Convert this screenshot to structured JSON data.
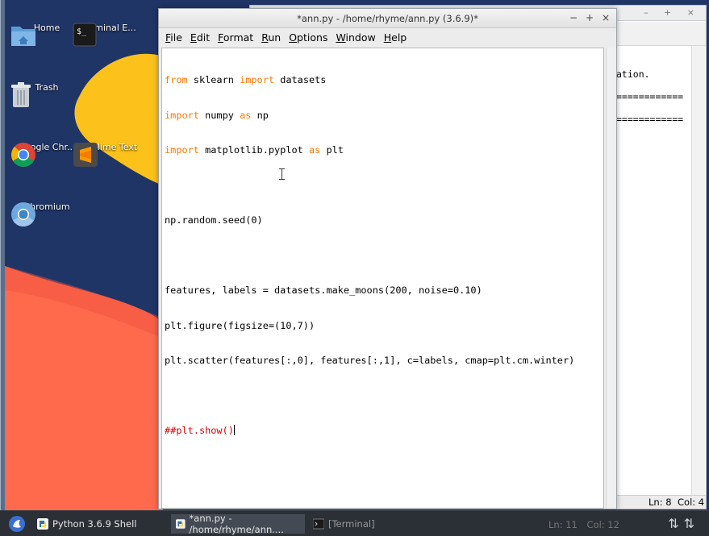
{
  "colors": {
    "desktop_bg": "#1f3566",
    "wave_orange": "#ff6a4d",
    "wave_yellow": "#fcc21b",
    "keyword": "#ff7700",
    "comment": "#dd0000",
    "taskbar_bg": "#2b2f36"
  },
  "desktop": {
    "icons": [
      {
        "label": "Home",
        "icon": "home-folder-icon"
      },
      {
        "label": "Terminal E...",
        "icon": "terminal-icon"
      },
      {
        "label": "Trash",
        "icon": "trash-icon"
      },
      {
        "label": "Google Chr...",
        "icon": "chrome-icon"
      },
      {
        "label": "Sublime Text",
        "icon": "sublime-icon"
      },
      {
        "label": "Chromium",
        "icon": "chromium-icon"
      }
    ]
  },
  "shell": {
    "text_lines": [
      "ation.",
      "",
      "============",
      "",
      "============"
    ],
    "status_ln": "Ln: 8",
    "status_col": "Col: 4"
  },
  "editor": {
    "title": "*ann.py - /home/rhyme/ann.py (3.6.9)*",
    "controls": {
      "minimize": "−",
      "maximize": "+",
      "close": "×"
    },
    "menu": [
      {
        "accel": "F",
        "rest": "ile"
      },
      {
        "accel": "E",
        "rest": "dit"
      },
      {
        "accel": "F",
        "rest": "ormat",
        "pre": ""
      },
      {
        "accel": "R",
        "rest": "un"
      },
      {
        "accel": "O",
        "rest": "ptions"
      },
      {
        "accel": "W",
        "rest": "indow"
      },
      {
        "accel": "H",
        "rest": "elp"
      }
    ],
    "code": {
      "line1": {
        "k1": "from",
        "t1": " sklearn ",
        "k2": "import",
        "t2": " datasets"
      },
      "line2": {
        "k1": "import",
        "t1": " numpy ",
        "k2": "as",
        "t2": " np"
      },
      "line3": {
        "k1": "import",
        "t1": " matplotlib.pyplot ",
        "k2": "as",
        "t2": " plt"
      },
      "line5": "np.random.seed(0)",
      "line7": "features, labels = datasets.make_moons(200, noise=0.10)",
      "line8": "plt.figure(figsize=(10,7))",
      "line9": "plt.scatter(features[:,0], features[:,1], c=labels, cmap=plt.cm.winter)",
      "line11": "##plt.show()"
    }
  },
  "taskbar": {
    "shell_task": "Python 3.6.9 Shell",
    "editor_task": "*ann.py - /home/rhyme/ann....",
    "terminal_task": "[Terminal]",
    "status_ln": "Ln: 11",
    "status_col": "Col: 12"
  }
}
